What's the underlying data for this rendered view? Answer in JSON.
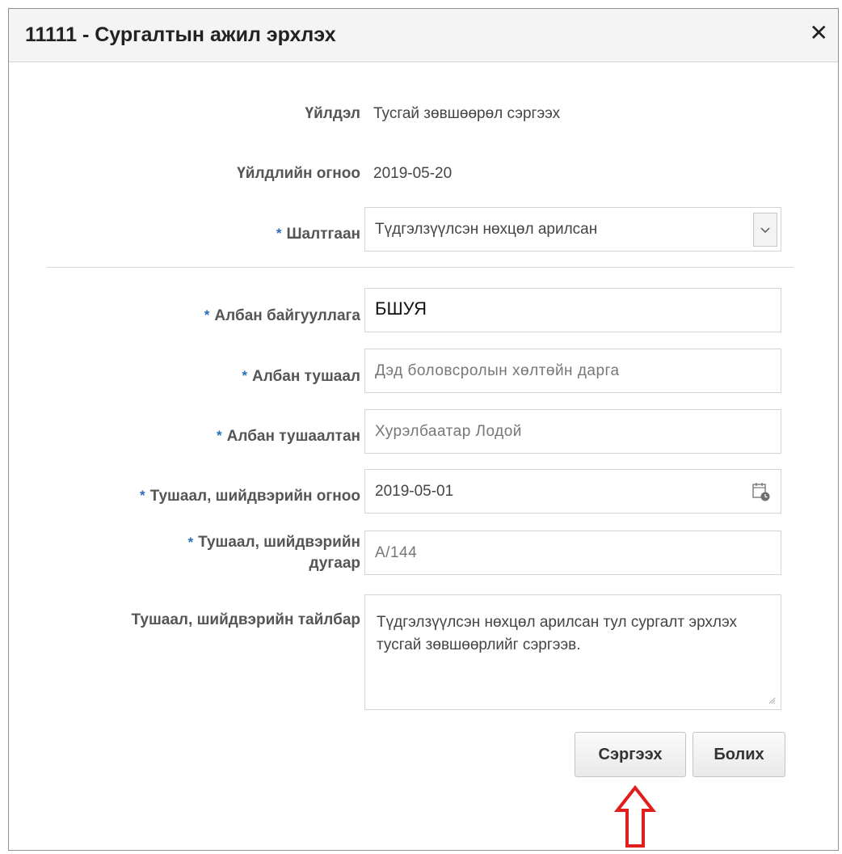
{
  "dialog": {
    "title": "11111 - Сургалтын ажил эрхлэх",
    "close_label": "✕"
  },
  "form": {
    "action": {
      "label": "Үйлдэл",
      "value": "Тусгай зөвшөөрөл сэргээх"
    },
    "action_date": {
      "label": "Үйлдлийн огноо",
      "value": "2019-05-20"
    },
    "reason": {
      "label": "Шалтгаан",
      "value": "Түдгэлзүүлсэн нөхцөл арилсан",
      "required": "*"
    },
    "organization": {
      "label": "Албан байгууллага",
      "value": "БШУЯ",
      "required": "*"
    },
    "position": {
      "label": "Албан тушаал",
      "value": "Дэд боловсролын хөлтөйн дарга",
      "required": "*"
    },
    "official": {
      "label": "Албан тушаалтан",
      "value": "Хурэлбаатар Лодой",
      "required": "*"
    },
    "decision_date": {
      "label": "Тушаал, шийдвэрийн огноо",
      "value": "2019-05-01",
      "required": "*"
    },
    "decision_number": {
      "label_line1": "Тушаал, шийдвэрийн",
      "label_line2": "дугаар",
      "value": "А/144",
      "required": "*"
    },
    "decision_note": {
      "label": "Тушаал, шийдвэрийн тайлбар",
      "value": "Түдгэлзүүлсэн нөхцөл арилсан тул сургалт эрхлэх тусгай зөвшөөрлийг сэргээв."
    }
  },
  "buttons": {
    "save_label": "Сэргээх",
    "cancel_label": "Болих"
  },
  "colors": {
    "required_star": "#2a6ebb",
    "annotation_arrow": "#e01e1e"
  }
}
